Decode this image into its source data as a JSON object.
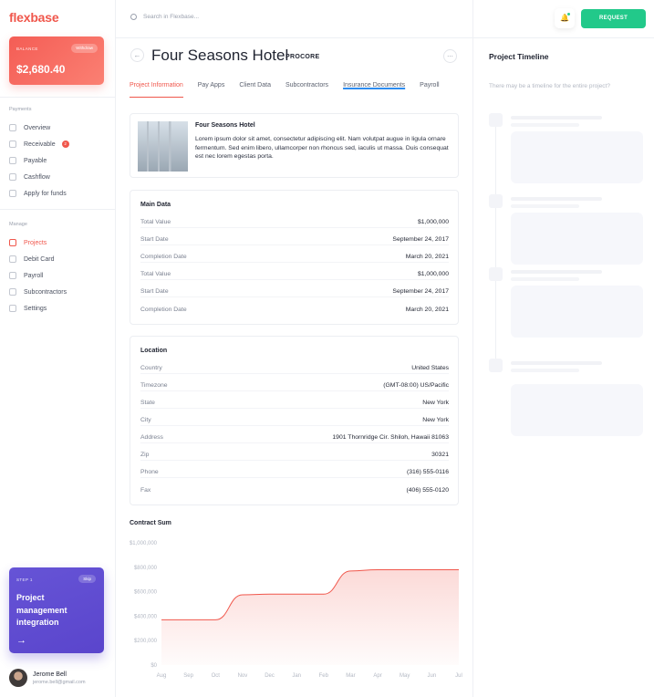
{
  "sidebar": {
    "logo": "flexbase",
    "balance": {
      "label": "BALANCE",
      "withdraw": "Withdraw",
      "amount": "$2,680.40"
    },
    "payments_label": "Payments",
    "payments": [
      {
        "label": "Overview",
        "icon": "overview-icon"
      },
      {
        "label": "Receivable",
        "icon": "receivable-icon",
        "badge": "2"
      },
      {
        "label": "Payable",
        "icon": "payable-icon"
      },
      {
        "label": "Cashflow",
        "icon": "cashflow-icon"
      },
      {
        "label": "Apply for funds",
        "icon": "funds-icon"
      }
    ],
    "manage_label": "Manage",
    "manage": [
      {
        "label": "Projects",
        "icon": "projects-icon",
        "active": true
      },
      {
        "label": "Debit Card",
        "icon": "card-icon"
      },
      {
        "label": "Payroll",
        "icon": "payroll-icon"
      },
      {
        "label": "Subcontractors",
        "icon": "subcontractors-icon"
      },
      {
        "label": "Settings",
        "icon": "settings-icon"
      }
    ],
    "promo": {
      "step": "STEP 1",
      "skip": "Skip",
      "title": "Project management integration",
      "arrow": "→"
    },
    "user": {
      "name": "Jerome Bell",
      "email": "jerome.bell@gmail.com"
    }
  },
  "header": {
    "search_placeholder": "Search in Flexbase..."
  },
  "project": {
    "back": "←",
    "title": "Four Seasons Hotel",
    "integration_logo": "PROCORE",
    "more": "...",
    "tabs": [
      "Project Information",
      "Pay Apps",
      "Client Data",
      "Subcontractors",
      "Insurance Documents",
      "Payroll"
    ],
    "hotel": {
      "name": "Four Seasons Hotel",
      "description": "Lorem ipsum dolor sit amet, consectetur adipiscing elit. Nam volutpat augue in ligula ornare fermentum. Sed enim libero, ullamcorper non rhoncus sed, iaculis ut massa. Duis consequat est nec lorem egestas porta."
    },
    "main_data": {
      "title": "Main Data",
      "rows": [
        {
          "k": "Total Value",
          "v": "$1,000,000"
        },
        {
          "k": "Start Date",
          "v": "September 24, 2017"
        },
        {
          "k": "Completion Date",
          "v": "March 20, 2021"
        },
        {
          "k": "Total Value",
          "v": "$1,000,000"
        },
        {
          "k": "Start Date",
          "v": "September 24, 2017"
        },
        {
          "k": "Completion Date",
          "v": "March 20, 2021"
        }
      ]
    },
    "location": {
      "title": "Location",
      "rows": [
        {
          "k": "Country",
          "v": "United States"
        },
        {
          "k": "Timezone",
          "v": "(GMT-08:00) US/Pacific"
        },
        {
          "k": "State",
          "v": "New York"
        },
        {
          "k": "City",
          "v": "New York"
        },
        {
          "k": "Address",
          "v": "1901 Thornridge Cir. Shiloh, Hawaii 81063"
        },
        {
          "k": "Zip",
          "v": "30321"
        },
        {
          "k": "Phone",
          "v": "(316) 555-0116"
        },
        {
          "k": "Fax",
          "v": "(406) 555-0120"
        }
      ]
    }
  },
  "chart_data": {
    "type": "area",
    "title": "Contract Sum",
    "categories": [
      "Aug",
      "Sep",
      "Oct",
      "Nov",
      "Dec",
      "Jan",
      "Feb",
      "Mar",
      "Apr",
      "May",
      "Jun",
      "Jul"
    ],
    "y_ticks": [
      "$0",
      "$200,000",
      "$400,000",
      "$600,000",
      "$800,000",
      "$1,000,000"
    ],
    "ylim": [
      0,
      1000000
    ],
    "values": [
      370000,
      370000,
      370000,
      575000,
      580000,
      580000,
      580000,
      770000,
      780000,
      780000,
      780000,
      780000
    ],
    "line_color": "#f0574c"
  },
  "timeline": {
    "title": "Project Timeline",
    "subtitle": "There may be a timeline for the entire project?",
    "request": "REQUEST",
    "bell": "🔔"
  }
}
